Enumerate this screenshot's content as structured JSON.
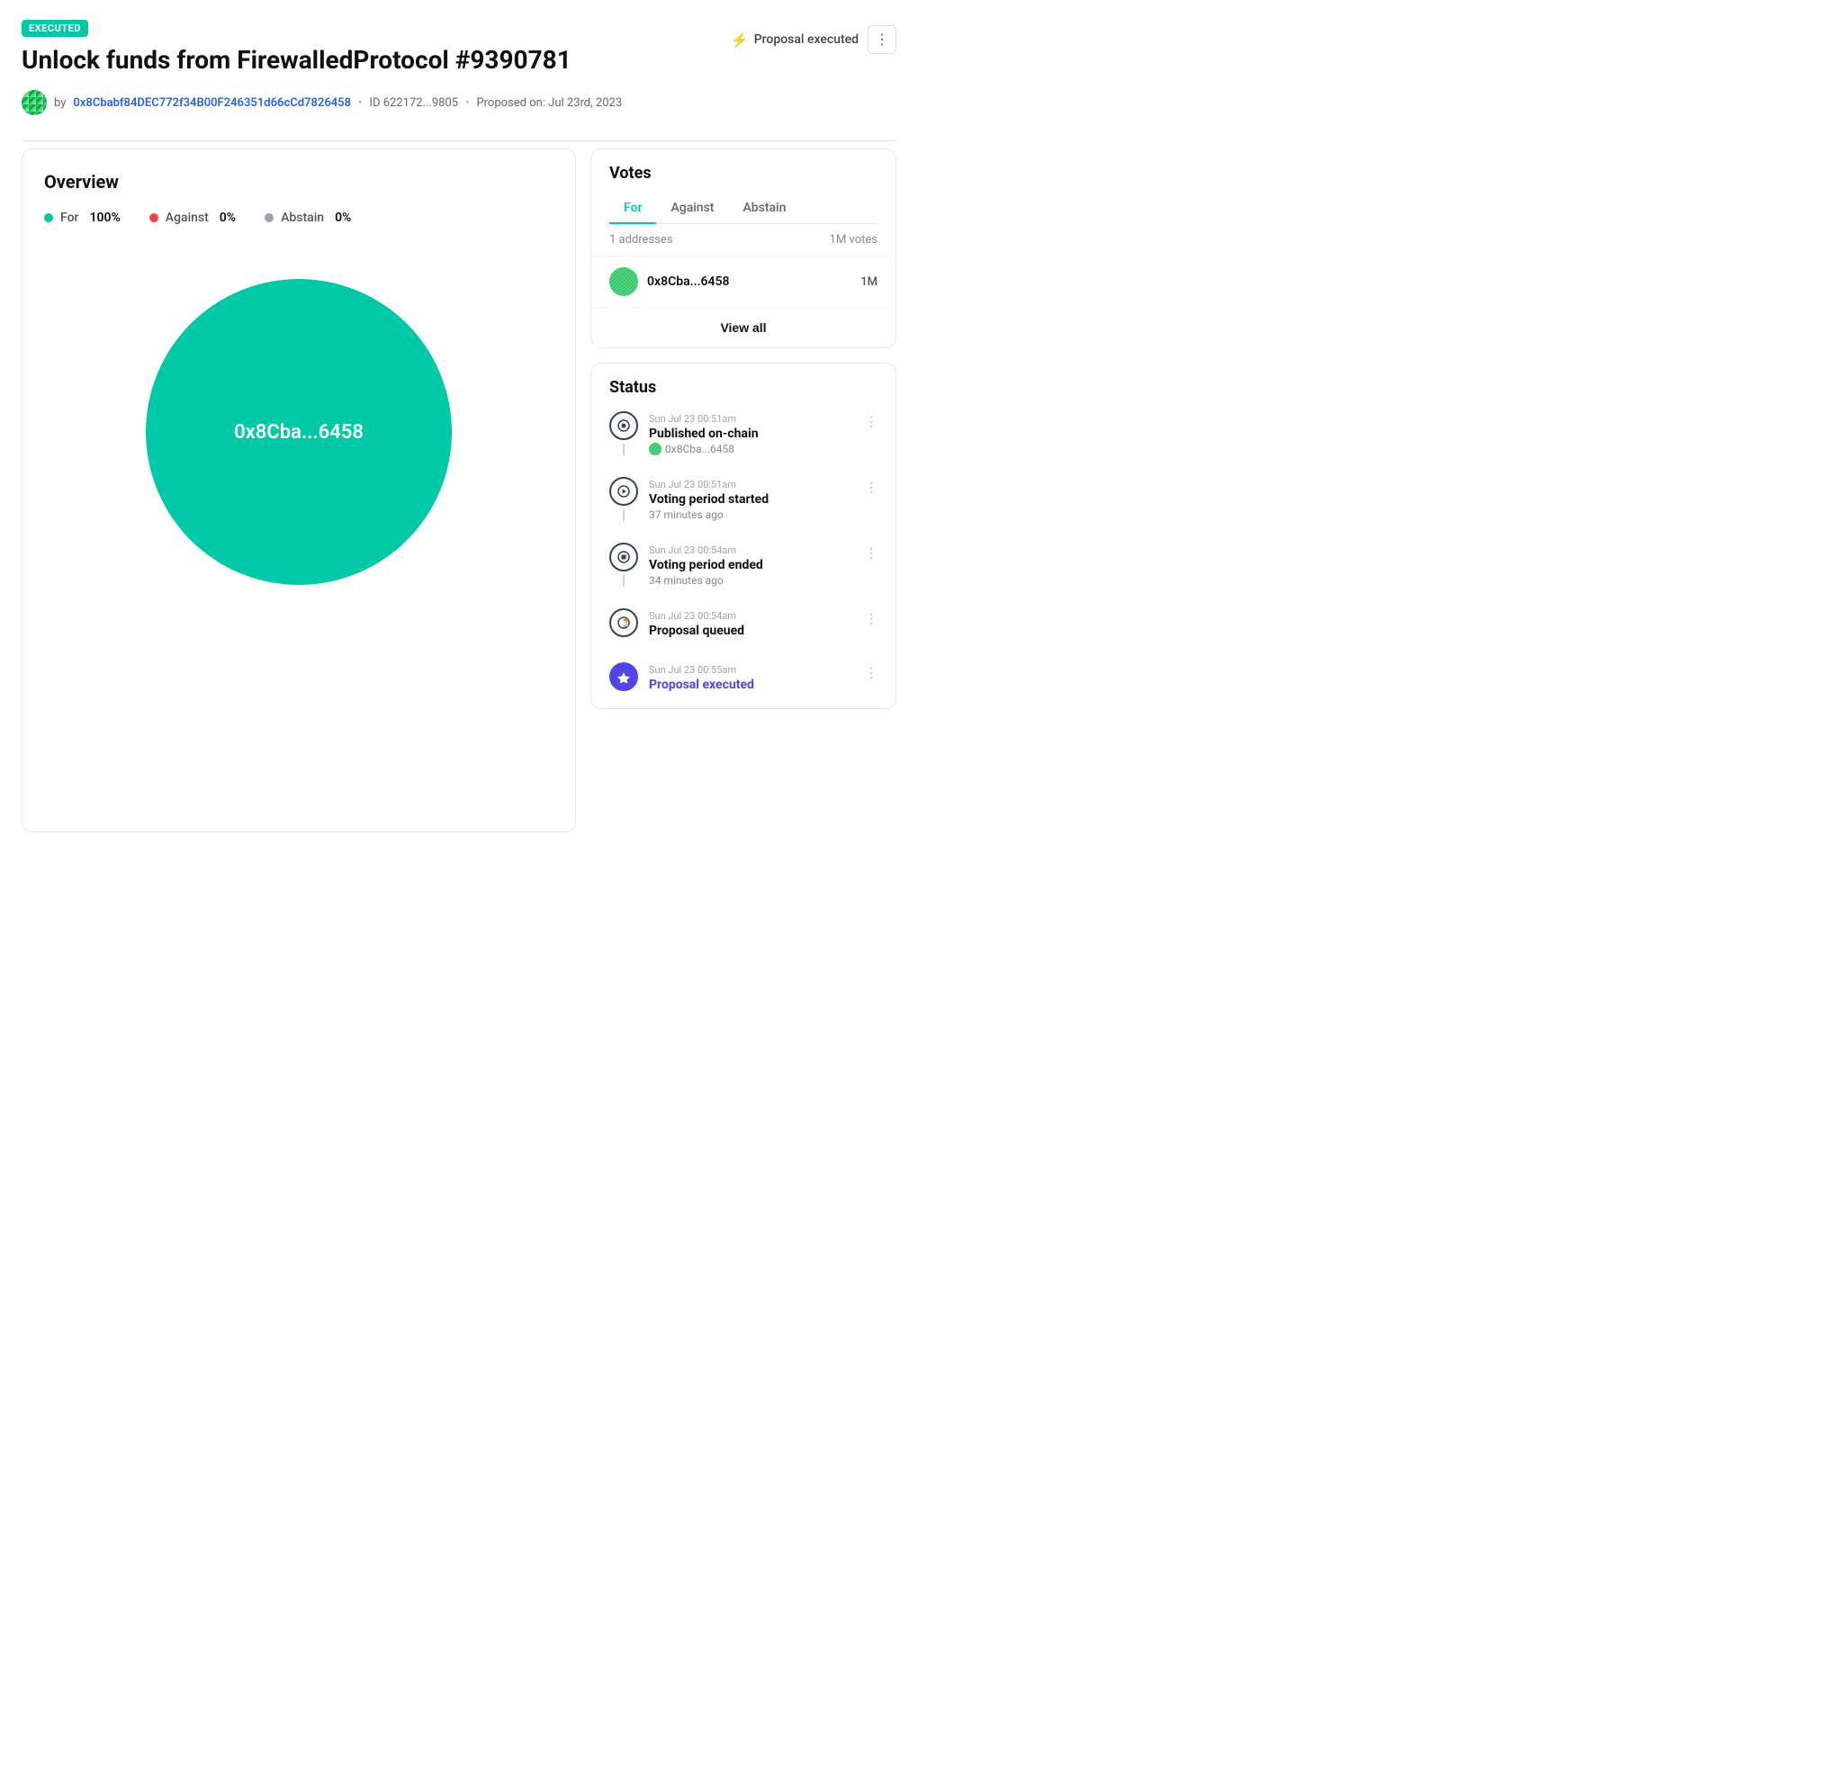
{
  "badge": {
    "label": "EXECUTED"
  },
  "header": {
    "title": "Unlock funds from FirewalledProtocol #9390781",
    "status_label": "Proposal executed",
    "more_icon": "⋮"
  },
  "author": {
    "address": "0x8Cbabf84DEC772f34B00F246351d66cCd7826458",
    "id_label": "ID 622172...9805",
    "proposed_label": "Proposed on: Jul 23rd, 2023"
  },
  "overview": {
    "section_title": "Overview",
    "votes": [
      {
        "label": "For",
        "pct": "100%",
        "type": "for"
      },
      {
        "label": "Against",
        "pct": "0%",
        "type": "against"
      },
      {
        "label": "Abstain",
        "pct": "0%",
        "type": "abstain"
      }
    ],
    "donut_label": "0x8Cba...6458"
  },
  "votes_panel": {
    "title": "Votes",
    "tabs": [
      "For",
      "Against",
      "Abstain"
    ],
    "active_tab": "For",
    "meta": {
      "addresses": "1 addresses",
      "votes_count": "1M votes"
    },
    "voter": {
      "address": "0x8Cba...6458",
      "votes": "1M"
    },
    "view_all_label": "View all"
  },
  "status_panel": {
    "title": "Status",
    "events": [
      {
        "icon": "📍",
        "icon_type": "normal",
        "date": "Sun Jul 23 00:51am",
        "title": "Published on-chain",
        "sub_address": "0x8Cba...6458",
        "has_avatar": true
      },
      {
        "icon": "▶",
        "icon_type": "normal",
        "date": "Sun Jul 23 00:51am",
        "title": "Voting period started",
        "sub_text": "37 minutes ago",
        "has_avatar": false
      },
      {
        "icon": "■",
        "icon_type": "normal",
        "date": "Sun Jul 23 00:54am",
        "title": "Voting period ended",
        "sub_text": "34 minutes ago",
        "has_avatar": false
      },
      {
        "icon": "⏳",
        "icon_type": "normal",
        "date": "Sun Jul 23 00:54am",
        "title": "Proposal queued",
        "sub_text": "",
        "has_avatar": false
      },
      {
        "icon": "⚡",
        "icon_type": "executed",
        "date": "Sun Jul 23 00:55am",
        "title": "Proposal executed",
        "sub_text": "",
        "has_avatar": false,
        "is_executed": true
      }
    ]
  }
}
